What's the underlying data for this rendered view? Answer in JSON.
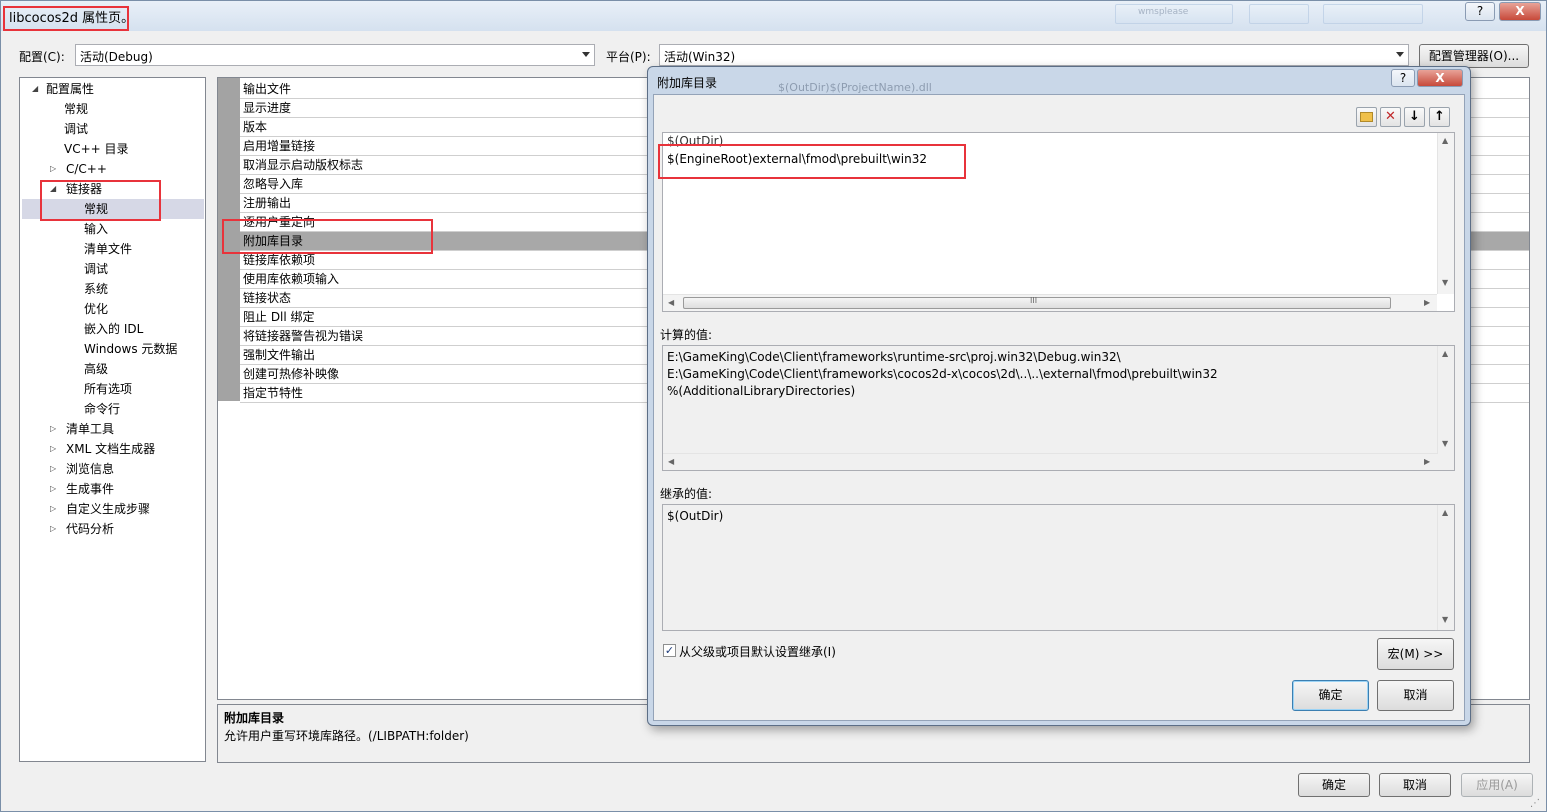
{
  "window": {
    "title": "libcocos2d 属性页。",
    "help_label": "?",
    "close_label": "X",
    "ghost_tab": "wmsplease"
  },
  "config_bar": {
    "config_label": "配置(C):",
    "config_value": "活动(Debug)",
    "platform_label": "平台(P):",
    "platform_value": "活动(Win32)",
    "manager_button": "配置管理器(O)..."
  },
  "tree": {
    "items": [
      {
        "label": "配置属性",
        "expander": "open"
      },
      {
        "label": "常规"
      },
      {
        "label": "调试"
      },
      {
        "label": "VC++ 目录"
      },
      {
        "label": "C/C++",
        "expander": "closed"
      },
      {
        "label": "链接器",
        "expander": "open"
      },
      {
        "label": "常规",
        "selected": true
      },
      {
        "label": "输入"
      },
      {
        "label": "清单文件"
      },
      {
        "label": "调试"
      },
      {
        "label": "系统"
      },
      {
        "label": "优化"
      },
      {
        "label": "嵌入的 IDL"
      },
      {
        "label": "Windows 元数据"
      },
      {
        "label": "高级"
      },
      {
        "label": "所有选项"
      },
      {
        "label": "命令行"
      },
      {
        "label": "清单工具",
        "expander": "closed"
      },
      {
        "label": "XML 文档生成器",
        "expander": "closed"
      },
      {
        "label": "浏览信息",
        "expander": "closed"
      },
      {
        "label": "生成事件",
        "expander": "closed"
      },
      {
        "label": "自定义生成步骤",
        "expander": "closed"
      },
      {
        "label": "代码分析",
        "expander": "closed"
      }
    ]
  },
  "properties": {
    "rows": [
      {
        "name": "输出文件"
      },
      {
        "name": "显示进度"
      },
      {
        "name": "版本"
      },
      {
        "name": "启用增量链接"
      },
      {
        "name": "取消显示启动版权标志"
      },
      {
        "name": "忽略导入库"
      },
      {
        "name": "注册输出"
      },
      {
        "name": "逐用户重定向"
      },
      {
        "name": "附加库目录",
        "selected": true
      },
      {
        "name": "链接库依赖项"
      },
      {
        "name": "使用库依赖项输入"
      },
      {
        "name": "链接状态"
      },
      {
        "name": "阻止 Dll 绑定"
      },
      {
        "name": "将链接器警告视为错误"
      },
      {
        "name": "强制文件输出"
      },
      {
        "name": "创建可热修补映像"
      },
      {
        "name": "指定节特性"
      }
    ]
  },
  "description": {
    "title": "附加库目录",
    "text": "允许用户重写环境库路径。(/LIBPATH:folder)"
  },
  "footer": {
    "ok": "确定",
    "cancel": "取消",
    "apply": "应用(A)"
  },
  "dialog": {
    "title": "附加库目录",
    "ghost_title": "$(OutDir)$(ProjectName).dll",
    "help_label": "?",
    "close_label": "X",
    "toolbar": {
      "new": "new-line",
      "delete": "✕",
      "down": "↓",
      "up": "↑"
    },
    "entries": [
      "$(OutDir)",
      "$(EngineRoot)external\\fmod\\prebuilt\\win32"
    ],
    "hscroll_grip": "III",
    "computed_label": "计算的值:",
    "computed_values": [
      "E:\\GameKing\\Code\\Client\\frameworks\\runtime-src\\proj.win32\\Debug.win32\\",
      "E:\\GameKing\\Code\\Client\\frameworks\\cocos2d-x\\cocos\\2d\\..\\..\\external\\fmod\\prebuilt\\win32",
      "%(AdditionalLibraryDirectories)"
    ],
    "inherited_label": "继承的值:",
    "inherited_values": [
      "$(OutDir)"
    ],
    "inherit_checkbox": "从父级或项目默认设置继承(I)",
    "inherit_checked": true,
    "macro_button": "宏(M) >>",
    "ok": "确定",
    "cancel": "取消"
  },
  "colors": {
    "highlight_box": "#e8333b",
    "selected_row": "#a8a8a8",
    "tree_selected": "#d6d8e6"
  }
}
